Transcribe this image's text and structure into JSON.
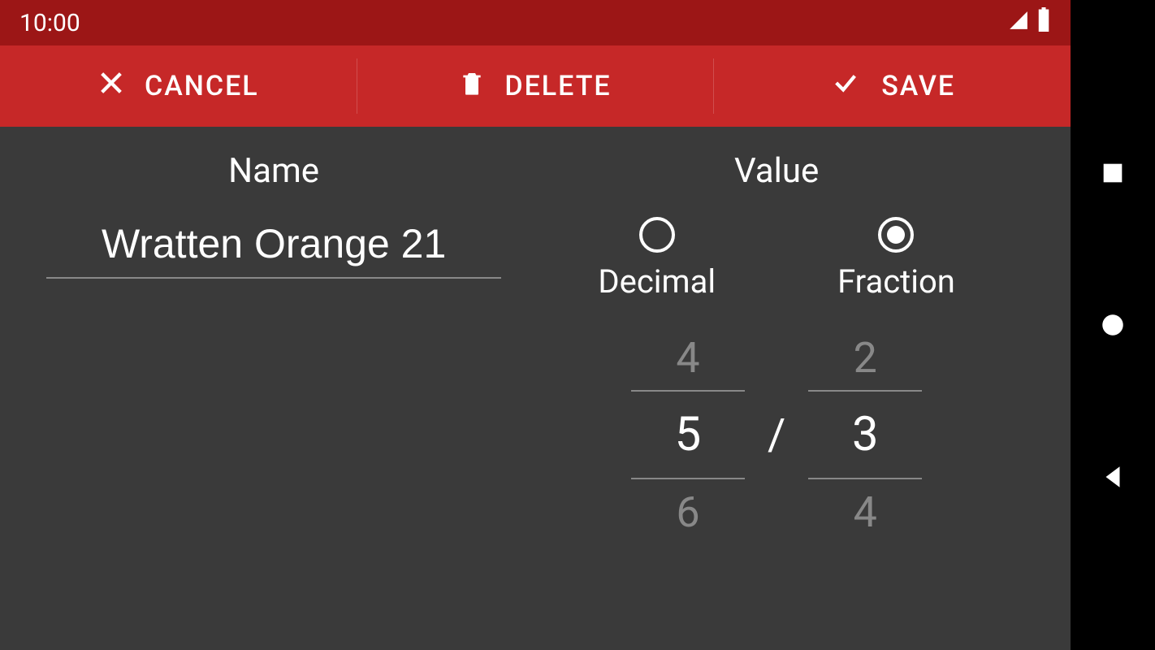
{
  "status": {
    "time": "10:00"
  },
  "actions": {
    "cancel": "CANCEL",
    "delete": "DELETE",
    "save": "SAVE"
  },
  "form": {
    "name_label": "Name",
    "name_value": "Wratten Orange 21",
    "value_label": "Value",
    "radio": {
      "decimal": "Decimal",
      "fraction": "Fraction",
      "selected": "fraction"
    },
    "fraction": {
      "numerator": {
        "prev": "4",
        "current": "5",
        "next": "6"
      },
      "separator": "/",
      "denominator": {
        "prev": "2",
        "current": "3",
        "next": "4"
      }
    }
  }
}
